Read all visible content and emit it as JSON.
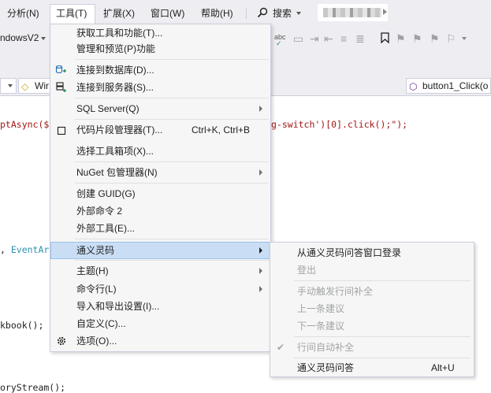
{
  "menubar": {
    "items": [
      "分析(N)",
      "工具(T)",
      "扩展(X)",
      "窗口(W)",
      "帮助(H)"
    ],
    "search_label": "搜索"
  },
  "toolbar": {
    "config_label": "ndowsV2"
  },
  "nav": {
    "project_label": "Wir",
    "member_label": "button1_Click(o"
  },
  "code": {
    "line1_a": "ptAsync($",
    "line1_b": "g-switch')[0].click();\");",
    "line2_a": ", ",
    "line2_type": "EventAr",
    "line3": "kbook();",
    "line4": "oryStream();"
  },
  "tools_menu": {
    "items": [
      {
        "label": "获取工具和功能(T)..."
      },
      {
        "label": "管理和预览(P)功能"
      },
      {
        "label": "连接到数据库(D)..."
      },
      {
        "label": "连接到服务器(S)..."
      },
      {
        "label": "SQL Server(Q)"
      },
      {
        "label": "代码片段管理器(T)...",
        "shortcut": "Ctrl+K, Ctrl+B"
      },
      {
        "label": "选择工具箱项(X)..."
      },
      {
        "label": "NuGet 包管理器(N)"
      },
      {
        "label": "创建 GUID(G)"
      },
      {
        "label": "外部命令 2"
      },
      {
        "label": "外部工具(E)..."
      },
      {
        "label": "通义灵码"
      },
      {
        "label": "主题(H)"
      },
      {
        "label": "命令行(L)"
      },
      {
        "label": "导入和导出设置(I)..."
      },
      {
        "label": "自定义(C)..."
      },
      {
        "label": "选项(O)..."
      }
    ]
  },
  "submenu": {
    "items": [
      {
        "label": "从通义灵码问答窗口登录"
      },
      {
        "label": "登出"
      },
      {
        "label": "手动触发行间补全"
      },
      {
        "label": "上一条建议"
      },
      {
        "label": "下一条建议"
      },
      {
        "label": "行间自动补全"
      },
      {
        "label": "通义灵码问答",
        "shortcut": "Alt+U"
      }
    ]
  },
  "colors": {
    "menu_bg": "#f6f6f6",
    "highlight_bg": "#c9def5",
    "chrome_bg": "#eeeef2",
    "disabled_text": "#a2a4a5"
  }
}
